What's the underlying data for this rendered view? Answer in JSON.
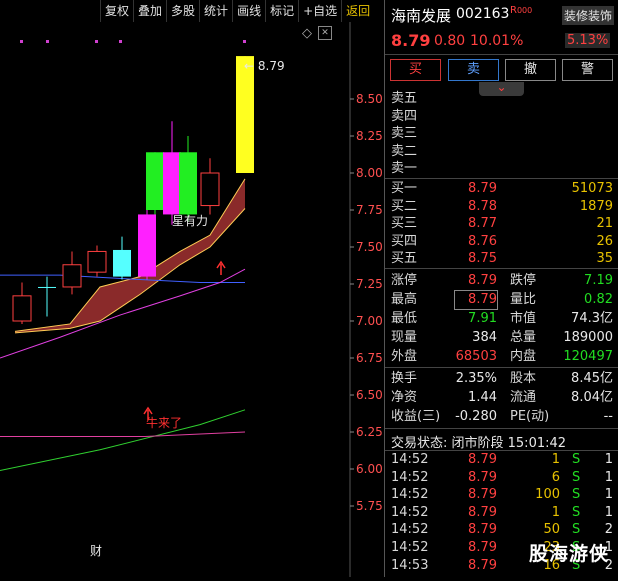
{
  "toolbar": {
    "items": [
      "复权",
      "叠加",
      "多股",
      "统计",
      "画线",
      "标记",
      "+自选",
      "返回"
    ]
  },
  "chart": {
    "price_labels": [
      "8.50",
      "8.25",
      "8.00",
      "7.75",
      "7.50",
      "7.25",
      "7.00",
      "6.75",
      "6.50",
      "6.25",
      "6.00",
      "5.75"
    ],
    "high_label": "8.79",
    "annotation_strong": "星有力",
    "annotation_bull": "牛来了",
    "finance_badge": "财",
    "diamond_icon": "◇",
    "dismiss_icon": "✕"
  },
  "chart_data": {
    "type": "candlestick",
    "ylim": [
      5.63,
      8.9
    ],
    "ticks": [
      8.5,
      8.25,
      8.0,
      7.75,
      7.5,
      7.25,
      7.0,
      6.75,
      6.5,
      6.25,
      6.0,
      5.75
    ],
    "ma_band_top": [
      [
        15,
        6.93
      ],
      [
        70,
        6.98
      ],
      [
        100,
        7.23
      ],
      [
        140,
        7.3
      ],
      [
        180,
        7.47
      ],
      [
        210,
        7.58
      ],
      [
        245,
        7.96
      ]
    ],
    "ma_band_bottom": [
      [
        15,
        6.92
      ],
      [
        70,
        6.95
      ],
      [
        100,
        7.0
      ],
      [
        140,
        7.18
      ],
      [
        180,
        7.38
      ],
      [
        210,
        7.5
      ],
      [
        245,
        7.76
      ]
    ],
    "ma_white": [
      [
        0,
        7.31
      ],
      [
        60,
        7.31
      ],
      [
        140,
        7.28
      ],
      [
        200,
        7.26
      ],
      [
        245,
        7.26
      ]
    ],
    "ma_magenta": [
      [
        0,
        6.75
      ],
      [
        60,
        6.89
      ],
      [
        120,
        7.04
      ],
      [
        180,
        7.17
      ],
      [
        220,
        7.26
      ],
      [
        245,
        7.35
      ]
    ],
    "ma_green_low": [
      [
        0,
        5.99
      ],
      [
        100,
        6.13
      ],
      [
        200,
        6.3
      ],
      [
        245,
        6.4
      ]
    ],
    "ma_pink_low": [
      [
        0,
        6.22
      ],
      [
        145,
        6.22
      ],
      [
        245,
        6.25
      ]
    ],
    "candles": [
      {
        "x": 22,
        "open": 7.0,
        "close": 7.17,
        "high": 7.26,
        "low": 6.98,
        "fill": "hollow-red"
      },
      {
        "x": 47,
        "open": 7.23,
        "close": 7.23,
        "high": 7.3,
        "low": 7.03,
        "fill": "cyan"
      },
      {
        "x": 72,
        "open": 7.23,
        "close": 7.38,
        "high": 7.47,
        "low": 7.18,
        "fill": "hollow-red"
      },
      {
        "x": 97,
        "open": 7.33,
        "close": 7.47,
        "high": 7.51,
        "low": 7.3,
        "fill": "hollow-red"
      },
      {
        "x": 122,
        "open": 7.48,
        "close": 7.3,
        "high": 7.57,
        "low": 7.28,
        "fill": "cyan"
      },
      {
        "x": 147,
        "open": 7.3,
        "close": 7.72,
        "high": 7.75,
        "low": 7.28,
        "fill": "magenta"
      },
      {
        "x": 155,
        "open": 8.14,
        "close": 7.75,
        "high": 8.14,
        "low": 7.72,
        "fill": "green"
      },
      {
        "x": 172,
        "open": 7.72,
        "close": 8.14,
        "high": 8.35,
        "low": 7.65,
        "fill": "magenta"
      },
      {
        "x": 188,
        "open": 8.14,
        "close": 7.72,
        "high": 8.25,
        "low": 7.67,
        "fill": "green"
      },
      {
        "x": 210,
        "open": 7.78,
        "close": 8.0,
        "high": 8.1,
        "low": 7.72,
        "fill": "hollow-red"
      },
      {
        "x": 245,
        "open": 8.0,
        "close": 8.79,
        "high": 8.79,
        "low": 8.0,
        "fill": "yellow"
      }
    ]
  },
  "quote": {
    "name": "海南发展",
    "code": "002163",
    "tag": "R",
    "count": "000",
    "sector_btn": "装修装饰",
    "price": "8.79",
    "change": "0.80",
    "pct": "10.01%",
    "sector_pct": "5.13%",
    "buy_btn": "买",
    "sell_btn": "卖",
    "cancel_btn": "撤",
    "alert_btn": "警",
    "chevron_icon": "⌄",
    "sell_levels": [
      "卖五",
      "卖四",
      "卖三",
      "卖二",
      "卖一"
    ],
    "buy_levels": [
      {
        "label": "买一",
        "price": "8.79",
        "vol": "51073"
      },
      {
        "label": "买二",
        "price": "8.78",
        "vol": "1879"
      },
      {
        "label": "买三",
        "price": "8.77",
        "vol": "21"
      },
      {
        "label": "买四",
        "price": "8.76",
        "vol": "26"
      },
      {
        "label": "买五",
        "price": "8.75",
        "vol": "35"
      }
    ],
    "stats": {
      "limit_up_label": "涨停",
      "limit_up": "8.79",
      "limit_down_label": "跌停",
      "limit_down": "7.19",
      "high_label": "最高",
      "high": "8.79",
      "vol_ratio_label": "量比",
      "vol_ratio": "0.82",
      "low_label": "最低",
      "low": "7.91",
      "mktcap_label": "市值",
      "mktcap": "74.3亿",
      "cur_vol_label": "现量",
      "cur_vol": "384",
      "total_vol_label": "总量",
      "total_vol": "189000",
      "outer_label": "外盘",
      "outer": "68503",
      "inner_label": "内盘",
      "inner": "120497",
      "turnover_label": "换手",
      "turnover": "2.35%",
      "shares_label": "股本",
      "shares": "8.45亿",
      "nav_label": "净资",
      "nav": "1.44",
      "float_label": "流通",
      "float": "8.04亿",
      "eps_label": "收益(三)",
      "eps": "-0.280",
      "pe_label": "PE(动)",
      "pe": "--"
    },
    "trade_status": "交易状态: 闭市阶段 15:01:42",
    "ticks": [
      {
        "time": "14:52",
        "price": "8.79",
        "vol": "1",
        "side": "S",
        "n": "1"
      },
      {
        "time": "14:52",
        "price": "8.79",
        "vol": "6",
        "side": "S",
        "n": "1"
      },
      {
        "time": "14:52",
        "price": "8.79",
        "vol": "100",
        "side": "S",
        "n": "1"
      },
      {
        "time": "14:52",
        "price": "8.79",
        "vol": "1",
        "side": "S",
        "n": "1"
      },
      {
        "time": "14:52",
        "price": "8.79",
        "vol": "50",
        "side": "S",
        "n": "2"
      },
      {
        "time": "14:52",
        "price": "8.79",
        "vol": "23",
        "side": "S",
        "n": "1"
      },
      {
        "time": "14:53",
        "price": "8.79",
        "vol": "16",
        "side": "S",
        "n": "2"
      }
    ]
  },
  "watermark": "股海游侠",
  "colors": {
    "up": "#ff4040",
    "down": "#22dd22",
    "flat": "#e8e8e8",
    "accent": "#e8c200"
  }
}
